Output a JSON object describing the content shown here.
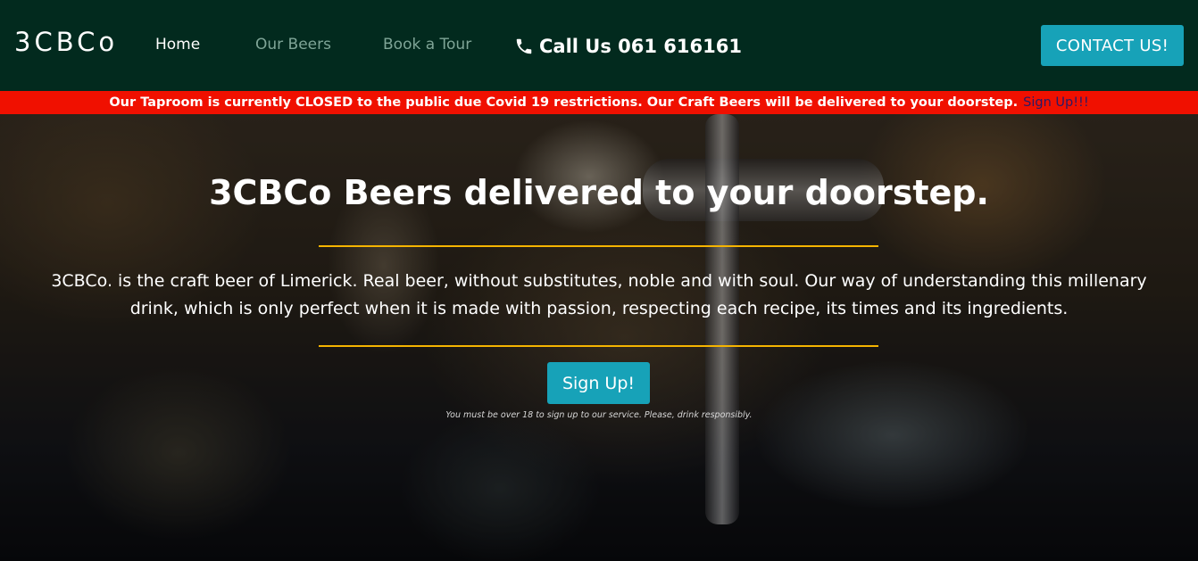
{
  "nav": {
    "brand": "3CBCo",
    "links": [
      {
        "label": "Home",
        "active": true
      },
      {
        "label": "Our Beers",
        "active": false
      },
      {
        "label": "Book a Tour",
        "active": false
      }
    ],
    "call_label": "Call Us 061 616161",
    "contact_label": "CONTACT US!"
  },
  "banner": {
    "text": "Our Taproom is currently CLOSED to the public due Covid 19 restrictions. Our Craft Beers will be delivered to your doorstep.",
    "link_label": "Sign Up!!!"
  },
  "hero": {
    "title": "3CBCo Beers delivered to your doorstep.",
    "description": "3CBCo. is the craft beer of Limerick. Real beer, without substitutes, noble and with soul. Our way of understanding this millenary drink, which is only perfect when it is made with passion, respecting each recipe, its times and its ingredients.",
    "signup_label": "Sign Up!",
    "disclaimer": "You must be over 18 to sign up to our service. Please, drink responsibly."
  },
  "colors": {
    "navbar_bg": "#022a1e",
    "accent_button": "#17a2b8",
    "banner_bg": "#f01000",
    "rule": "#f5b400"
  },
  "icons": [
    "phone-icon"
  ]
}
